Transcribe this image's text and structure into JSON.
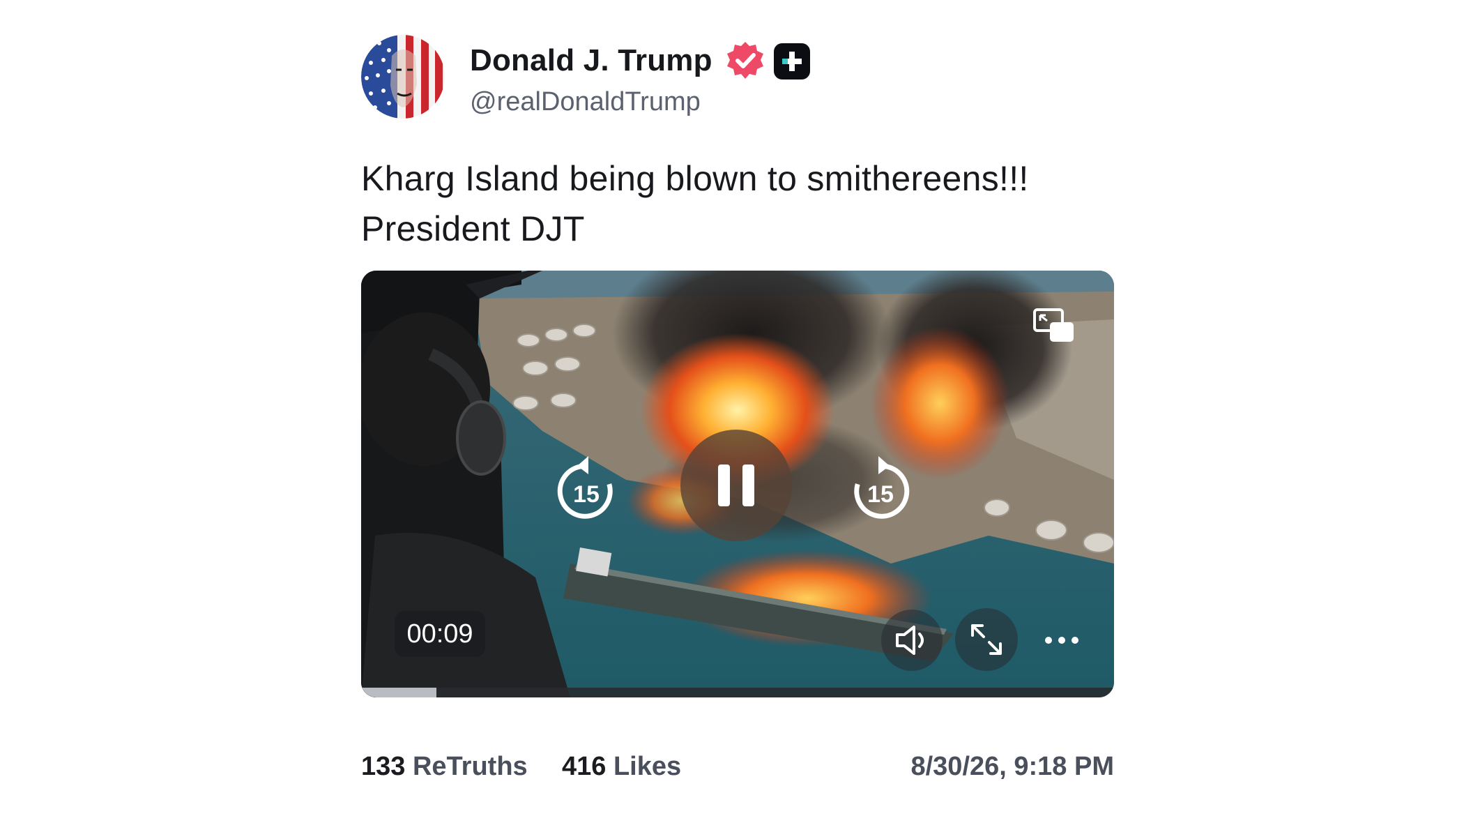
{
  "author": {
    "display_name": "Donald J. Trump",
    "handle": "@realDonaldTrump",
    "verified_badge_color": "#ee4a68",
    "avatar_icon": "flag-portrait-avatar"
  },
  "post": {
    "lines": [
      "Kharg Island being blown to smithereens!!!",
      "President DJT"
    ]
  },
  "video": {
    "timecode": "00:09",
    "rewind_seconds": "15",
    "forward_seconds": "15",
    "progress_fraction": 0.1,
    "state": "playing",
    "icons": {
      "pip": "picture-in-picture-icon",
      "rewind": "rewind-15-icon",
      "pause": "pause-icon",
      "forward": "forward-15-icon",
      "volume": "speaker-icon",
      "fullscreen": "expand-icon",
      "more": "more-dots-icon"
    }
  },
  "stats": {
    "retruths_count": "133",
    "retruths_label": "ReTruths",
    "likes_count": "416",
    "likes_label": "Likes",
    "timestamp": "8/30/26, 9:18 PM"
  }
}
